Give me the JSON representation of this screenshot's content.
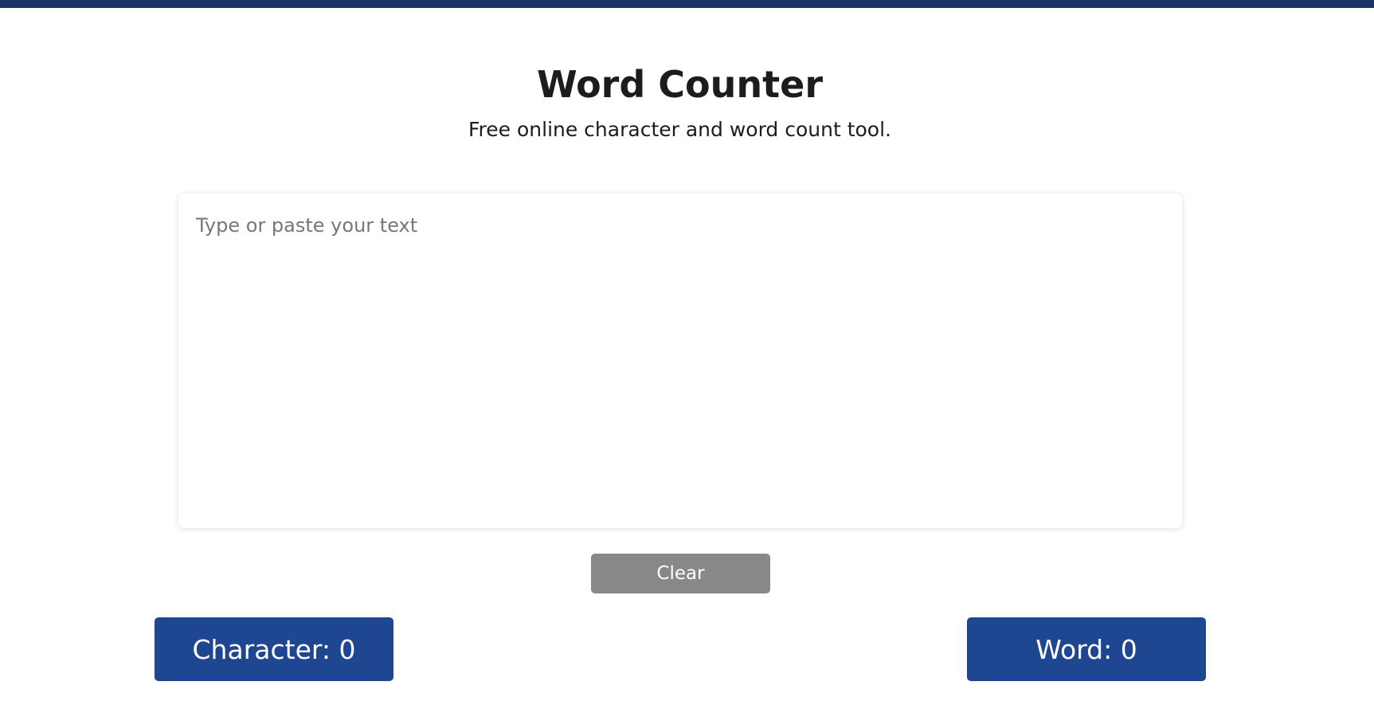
{
  "header": {
    "title": "Word Counter",
    "subtitle": "Free online character and word count tool."
  },
  "editor": {
    "value": "",
    "placeholder": "Type or paste your text"
  },
  "actions": {
    "clear_label": "Clear"
  },
  "stats": {
    "character_label": "Character: 0",
    "word_label": "Word: 0",
    "character_count": 0,
    "word_count": 0
  },
  "colors": {
    "top_bar": "#1c3566",
    "stat_box": "#1f4690",
    "clear_button": "#888888",
    "title_text": "#1c1c1c"
  }
}
